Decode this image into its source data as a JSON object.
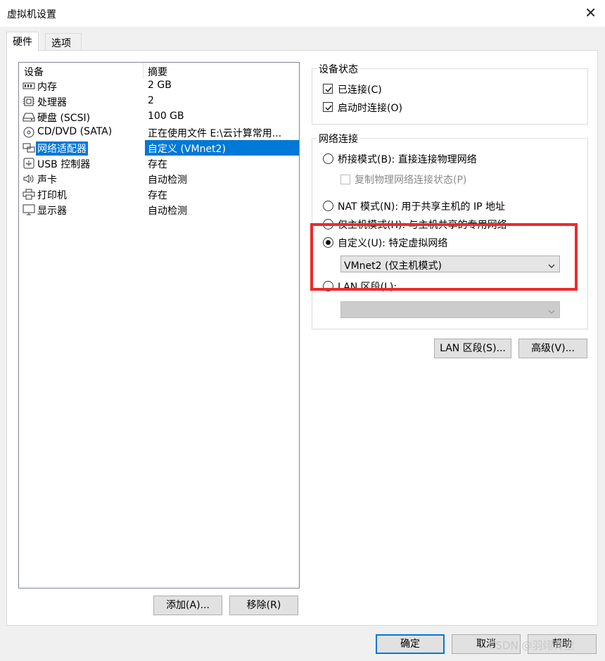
{
  "window": {
    "title": "虚拟机设置"
  },
  "tabs": [
    {
      "label": "硬件"
    },
    {
      "label": "选项"
    }
  ],
  "device_list": {
    "columns": [
      "设备",
      "摘要"
    ],
    "rows": [
      {
        "name": "内存",
        "summary": "2 GB",
        "icon": "memory-icon"
      },
      {
        "name": "处理器",
        "summary": "2",
        "icon": "processor-icon"
      },
      {
        "name": "硬盘 (SCSI)",
        "summary": "100 GB",
        "icon": "hard-disk-icon"
      },
      {
        "name": "CD/DVD (SATA)",
        "summary": "正在使用文件 E:\\云计算常用...",
        "icon": "cd-dvd-icon"
      },
      {
        "name": "网络适配器",
        "summary": "自定义 (VMnet2)",
        "icon": "network-adapter-icon"
      },
      {
        "name": "USB 控制器",
        "summary": "存在",
        "icon": "usb-icon"
      },
      {
        "name": "声卡",
        "summary": "自动检测",
        "icon": "sound-icon"
      },
      {
        "name": "打印机",
        "summary": "存在",
        "icon": "printer-icon"
      },
      {
        "name": "显示器",
        "summary": "自动检测",
        "icon": "display-icon"
      }
    ],
    "selected_index": 4
  },
  "list_buttons": {
    "add": "添加(A)...",
    "remove": "移除(R)"
  },
  "device_status": {
    "legend": "设备状态",
    "connected": "已连接(C)",
    "connect_on_power": "启动时连接(O)"
  },
  "network": {
    "legend": "网络连接",
    "bridged": "桥接模式(B): 直接连接物理网络",
    "replicate": "复制物理网络连接状态(P)",
    "nat": "NAT 模式(N): 用于共享主机的 IP 地址",
    "host_only": "仅主机模式(H): 与主机共享的专用网络",
    "custom": "自定义(U): 特定虚拟网络",
    "custom_value": "VMnet2 (仅主机模式)",
    "lan": "LAN 区段(L):",
    "lan_value": ""
  },
  "network_buttons": {
    "lan_segments": "LAN 区段(S)...",
    "advanced": "高级(V)..."
  },
  "footer": {
    "ok": "确定",
    "cancel": "取消",
    "help": "帮助"
  },
  "watermark": "CSDN @羽翊青空",
  "colors": {
    "selection": "#0078d7",
    "highlight_box": "#ee2a2a"
  }
}
